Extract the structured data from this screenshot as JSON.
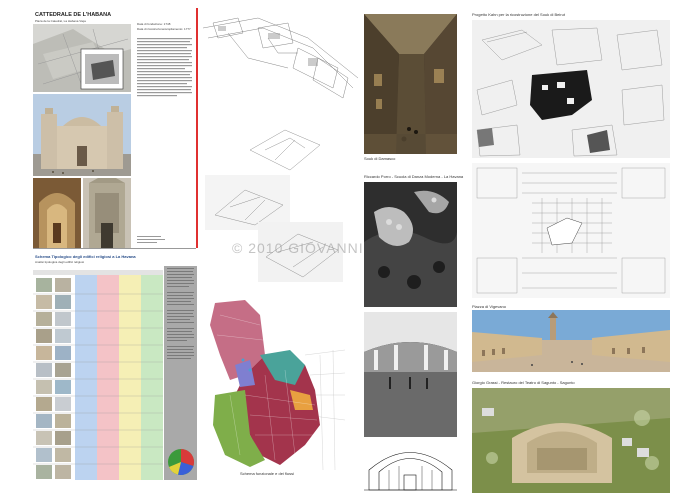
{
  "panel1": {
    "title": "CATTEDRALE DE L'HABANA",
    "subtitle": "Plaza de la Catedral, La Habana Vieja",
    "field1": "Data di fondazione: 1748",
    "field2": "Data di ricostruzione/ampliamento: 1777"
  },
  "table": {
    "title": "Schema Tipologico degli edifici religiosi a La Havana",
    "subtitle": "Analisi tipologica degli edifici religiosi"
  },
  "watermark": "© 2010 GIOVANNI",
  "captions": {
    "souk": "Souk di Damasco",
    "porro": "Riccardo Porro - Scuola di Danza Moderna - La Havana",
    "kahn": "Progetto Kahn per la ricostruzione del Souk di Beirut",
    "vigevano": "Piazza di Vigevano",
    "grassi": "Giorgio Grassi - Restauro del Teatro di Sagunto - Sagunto",
    "schema": "Schema funzionale e dei flussi"
  },
  "colors": {
    "accent_red": "#e03030",
    "map_red": "#a3344c",
    "map_green": "#7fae4a",
    "map_teal": "#4aa39a"
  }
}
